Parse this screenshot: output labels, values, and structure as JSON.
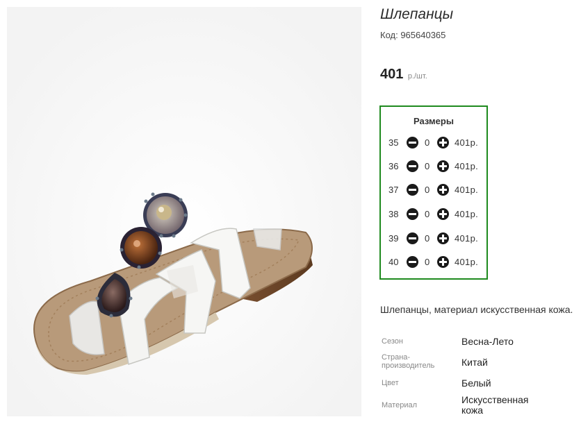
{
  "product": {
    "title": "Шлепанцы",
    "code": "Код: 965640365",
    "price_amount": "401",
    "price_unit": "р./шт."
  },
  "sizes": {
    "title": "Размеры",
    "rows": [
      {
        "size": "35",
        "qty": "0",
        "price": "401р."
      },
      {
        "size": "36",
        "qty": "0",
        "price": "401р."
      },
      {
        "size": "37",
        "qty": "0",
        "price": "401р."
      },
      {
        "size": "38",
        "qty": "0",
        "price": "401р."
      },
      {
        "size": "39",
        "qty": "0",
        "price": "401р."
      },
      {
        "size": "40",
        "qty": "0",
        "price": "401р."
      }
    ]
  },
  "description": "Шлепанцы, материал искусственная кожа.",
  "specs": [
    {
      "label": "Сезон",
      "value": "Весна-Лето"
    },
    {
      "label": "Страна-производитель",
      "value": "Китай"
    },
    {
      "label": "Цвет",
      "value": "Белый"
    },
    {
      "label": "Материал",
      "value": "Искусственная кожа"
    }
  ],
  "colors": {
    "accent_border": "#1e8a1e",
    "button_fill": "#1a1a1a"
  },
  "icons": [
    "minus-circle-icon",
    "plus-circle-icon"
  ]
}
